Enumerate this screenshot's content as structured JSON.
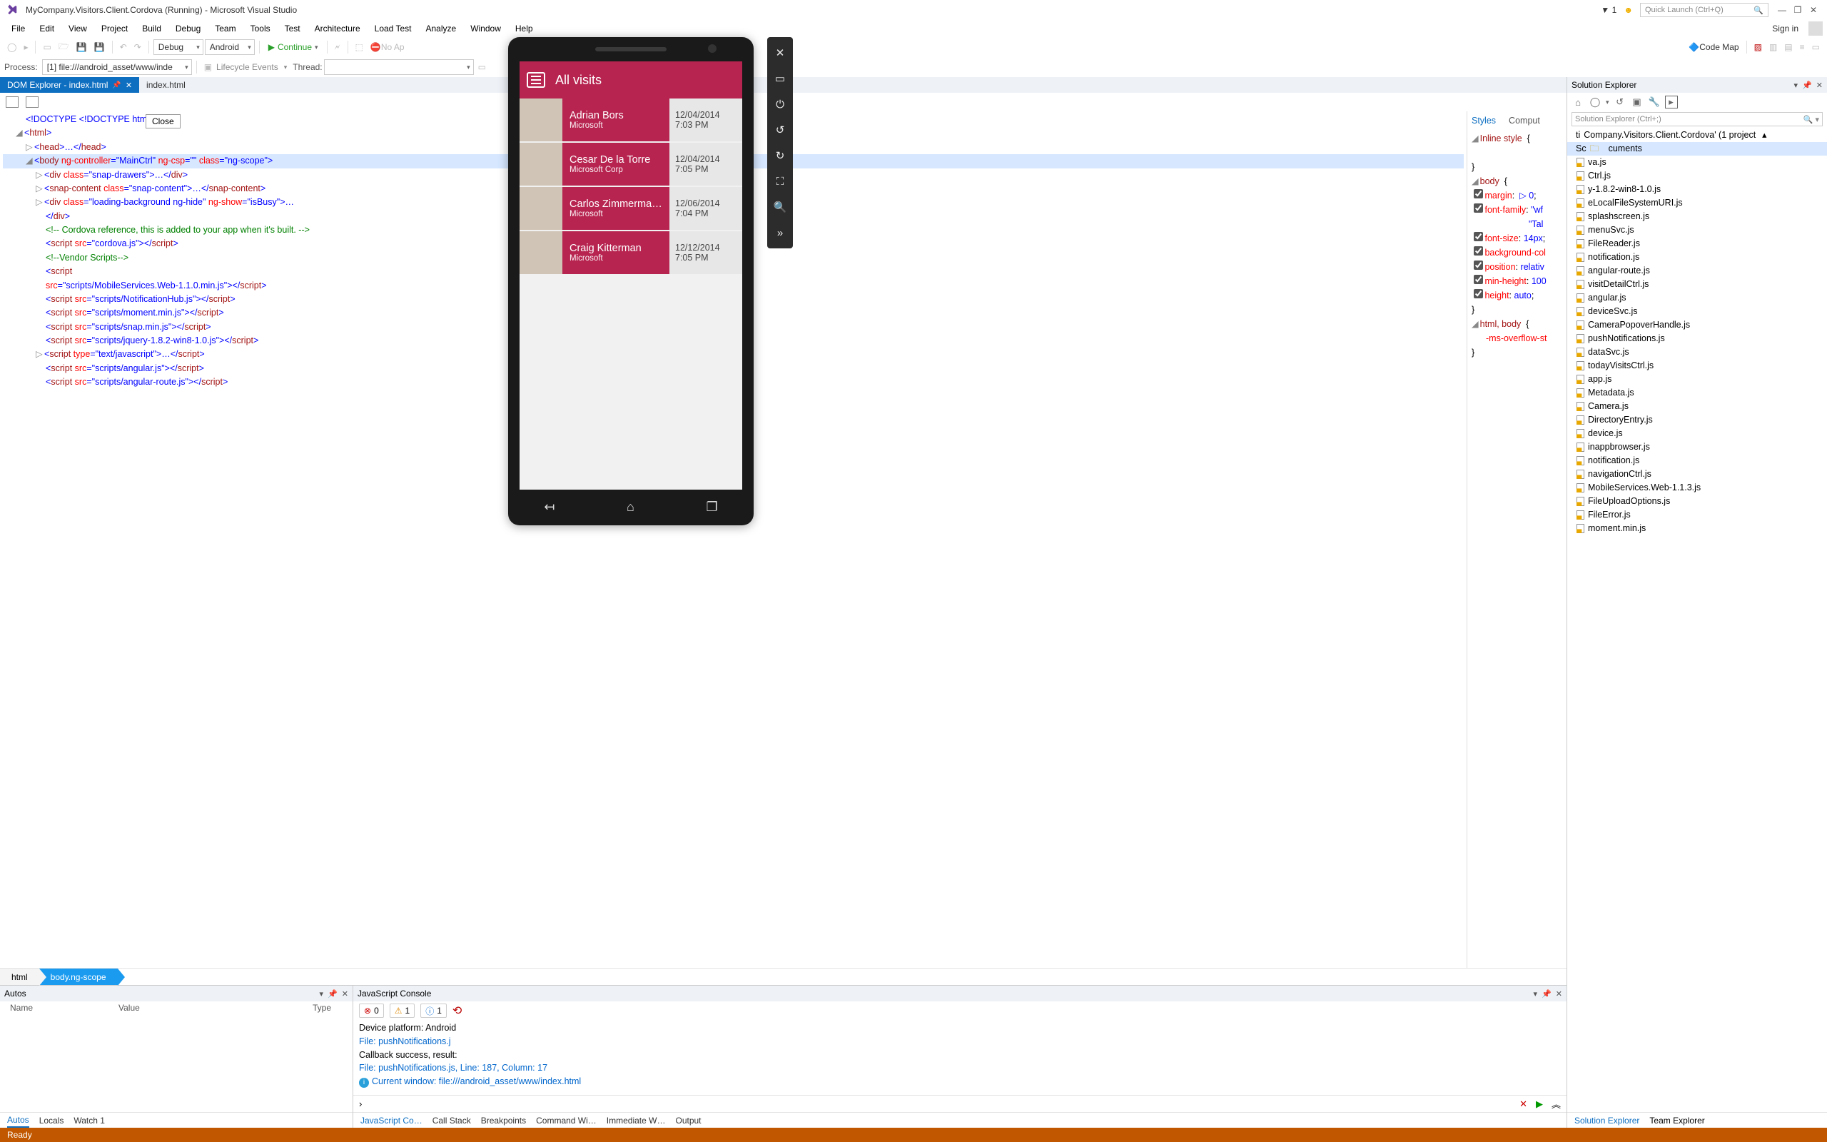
{
  "title": "MyCompany.Visitors.Client.Cordova (Running) - Microsoft Visual Studio",
  "notif_count": "1",
  "quick_launch_placeholder": "Quick Launch (Ctrl+Q)",
  "menu": [
    "File",
    "Edit",
    "View",
    "Project",
    "Build",
    "Debug",
    "Team",
    "Tools",
    "Test",
    "Architecture",
    "Load Test",
    "Analyze",
    "Window",
    "Help"
  ],
  "signin": "Sign in",
  "toolbar1": {
    "config": "Debug",
    "platform": "Android",
    "continue": "Continue",
    "noapp": "No Ap",
    "codemap": "Code Map"
  },
  "toolbar2": {
    "process_label": "Process:",
    "process_value": "[1] file:///android_asset/www/inde",
    "lifecycle": "Lifecycle Events",
    "thread_label": "Thread:"
  },
  "tabs": {
    "active": "DOM Explorer - index.html",
    "inactive": "index.html"
  },
  "close_tooltip": "Close",
  "dom_lines": {
    "l0": "<!DOCTYPE <!DOCTYPE html>>",
    "l1_open": "<",
    "l1_tag": "html",
    "l1_close": ">",
    "l2": "head",
    "l2_rest": ">…</",
    "l2_rest2": ">",
    "l3": "body",
    "l3_a1": "ng-controller",
    "l3_v1": "\"MainCtrl\"",
    "l3_a2": "ng-csp",
    "l3_v2": "\"\"",
    "l3_a3": "class",
    "l3_v3": "\"ng-scope\"",
    "l4": "div",
    "l4_a": "class",
    "l4_v": "\"snap-drawers\"",
    "l4_rest": ">…</",
    "l4_tag2": "div",
    "l4_end": ">",
    "l5": "snap-content",
    "l5_a": "class",
    "l5_v": "\"snap-content\"",
    "l5_rest": ">…</",
    "l5_end": ">",
    "l6": "div",
    "l6_a1": "class",
    "l6_v1": "\"loading-background ng-hide\"",
    "l6_a2": "ng-show",
    "l6_v2": "\"isBusy\"",
    "l6_rest": ">…",
    "l6b": "</",
    "l6b_tag": "div",
    "l6b_end": ">",
    "l7": "<!-- Cordova reference, this is added to your app when it's built. -->",
    "l8": "script",
    "l8_a": "src",
    "l8_v": "\"cordova.js\"",
    "l8_rest": "></",
    "l8_end": ">",
    "l9": "<!--Vendor Scripts-->",
    "l10": "script",
    "l11_a": "src",
    "l11_v": "\"scripts/MobileServices.Web-1.1.0.min.js\"",
    "l11_rest": "></",
    "l11_tag": "script",
    "l11_end": ">",
    "l12_v": "\"scripts/NotificationHub.js\"",
    "l13_v": "\"scripts/moment.min.js\"",
    "l14_v": "\"scripts/snap.min.js\"",
    "l15_v": "\"scripts/jquery-1.8.2-win8-1.0.js\"",
    "l16": "script",
    "l16_a": "type",
    "l16_v": "\"text/javascript\"",
    "l16_rest": ">…</",
    "l16_end": ">",
    "l17_v": "\"scripts/angular.js\"",
    "l18_v": "\"scripts/angular-route.js\""
  },
  "crumbs": {
    "a": "html",
    "b": "body.ng-scope"
  },
  "styles": {
    "tab_a": "Styles",
    "tab_b": "Comput",
    "r0": "Inline style",
    "brace": "{",
    "brace2": "}",
    "sel_body": "body",
    "p_margin": "margin",
    "v_margin": "▷ 0",
    "p_ff": "font-family",
    "v_ff": "\"wf",
    "v_ff2": "\"Tal",
    "p_fs": "font-size",
    "v_fs": "14px",
    "p_bg": "background-col",
    "p_pos": "position",
    "v_pos": "relativ",
    "p_mh": "min-height",
    "v_mh": "100",
    "p_h": "height",
    "v_h": "auto",
    "sel_hb": "html, body",
    "p_ms": "-ms-overflow-st"
  },
  "autos": {
    "title": "Autos",
    "cols": [
      "Name",
      "Value",
      "Type"
    ],
    "tabs": [
      "Autos",
      "Locals",
      "Watch 1"
    ]
  },
  "js": {
    "title": "JavaScript Console",
    "err": "0",
    "warn": "1",
    "info": "1",
    "lines": [
      {
        "cls": "",
        "t": "Device platform: Android"
      },
      {
        "cls": "file",
        "t": "File: pushNotifications.j"
      },
      {
        "cls": "",
        "t": "Callback success, result:"
      },
      {
        "cls": "file",
        "t": "File: pushNotifications.js, Line: 187, Column: 17"
      },
      {
        "cls": "info",
        "t": "Current window: file:///android_asset/www/index.html",
        "icon": true
      }
    ],
    "tabs": [
      "JavaScript Co…",
      "Call Stack",
      "Breakpoints",
      "Command Wi…",
      "Immediate W…",
      "Output"
    ]
  },
  "sol": {
    "title": "Solution Explorer",
    "search": "Solution Explorer (Ctrl+;)",
    "root": "Company.Visitors.Client.Cordova' (1 project",
    "folder_sel": "cuments",
    "files": [
      "va.js",
      "Ctrl.js",
      "y-1.8.2-win8-1.0.js",
      "eLocalFileSystemURI.js",
      "splashscreen.js",
      "menuSvc.js",
      "FileReader.js",
      "notification.js",
      "angular-route.js",
      "visitDetailCtrl.js",
      "angular.js",
      "deviceSvc.js",
      "CameraPopoverHandle.js",
      "pushNotifications.js",
      "dataSvc.js",
      "todayVisitsCtrl.js",
      "app.js",
      "Metadata.js",
      "Camera.js",
      "DirectoryEntry.js",
      "device.js",
      "inappbrowser.js",
      "notification.js",
      "navigationCtrl.js",
      "MobileServices.Web-1.1.3.js",
      "FileUploadOptions.js",
      "FileError.js",
      "moment.min.js"
    ],
    "tabs": [
      "Solution Explorer",
      "Team Explorer"
    ]
  },
  "status": "Ready",
  "emu": {
    "title": "All visits",
    "rows": [
      {
        "n": "Adrian Bors",
        "c": "Microsoft",
        "d": "12/04/2014",
        "t": "7:03 PM"
      },
      {
        "n": "Cesar De la Torre",
        "c": "Microsoft Corp",
        "d": "12/04/2014",
        "t": "7:05 PM"
      },
      {
        "n": "Carlos Zimmerma…",
        "c": "Microsoft",
        "d": "12/06/2014",
        "t": "7:04 PM"
      },
      {
        "n": "Craig Kitterman",
        "c": "Microsoft",
        "d": "12/12/2014",
        "t": "7:05 PM"
      }
    ]
  }
}
